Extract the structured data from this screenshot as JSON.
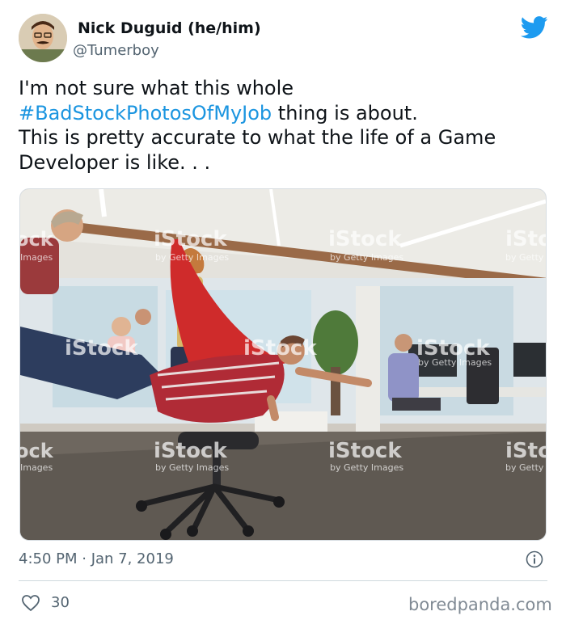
{
  "author": {
    "name": "Nick Duguid (he/him)",
    "handle": "@Tumerboy",
    "avatar_icon": "profile-photo"
  },
  "tweet": {
    "text_before": "I'm not sure what this whole",
    "hashtag": "#BadStockPhotosOfMyJob",
    "text_after_hashtag": " thing is about.",
    "text_line3": "This is pretty accurate to what the life of a Game",
    "text_line4": "Developer is like. . .",
    "timestamp": "4:50 PM · Jan 7, 2019",
    "likes": "30"
  },
  "media": {
    "watermark_brand": "iStock",
    "watermark_sub": "by Getty Images",
    "watermark_edge": "Images",
    "watermark_edge_left": "ock",
    "watermark_edge_right": "iSto",
    "watermark_edge_right_sub": "by Getty"
  },
  "footer": {
    "source": "boredpanda.com"
  },
  "colors": {
    "link": "#1b95e0",
    "twitter_blue": "#1d9bf0",
    "muted": "#536471",
    "divider": "#cfd9de"
  },
  "icons": [
    "twitter-bird-icon",
    "info-icon",
    "heart-icon"
  ]
}
